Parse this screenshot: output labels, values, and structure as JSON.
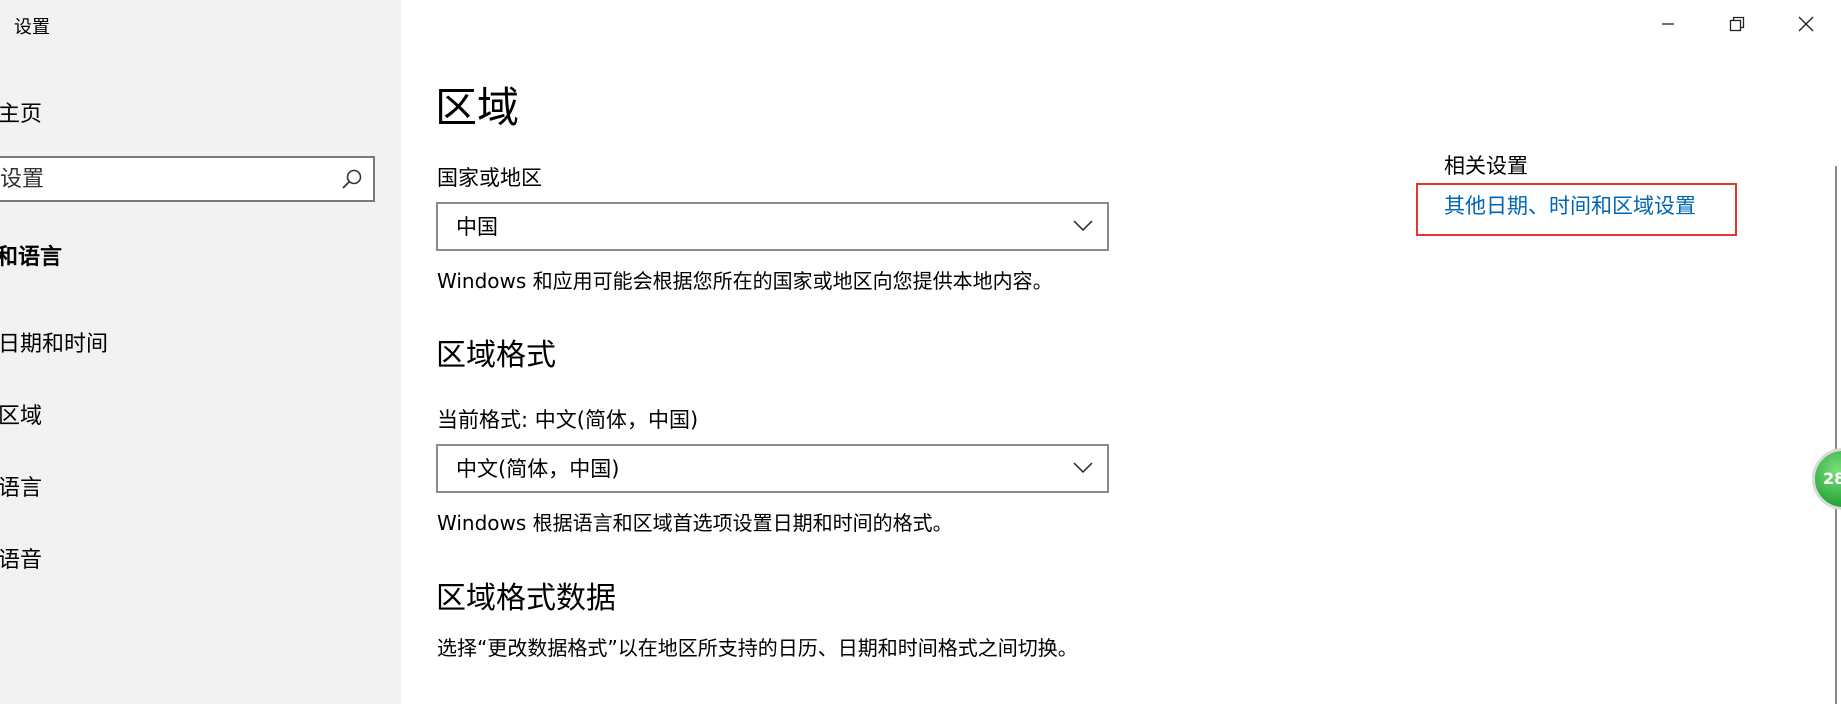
{
  "window": {
    "title": "设置"
  },
  "sidebar": {
    "home": "主页",
    "search_placeholder": "设置",
    "section": "和语言",
    "items": [
      {
        "label": "日期和时间"
      },
      {
        "label": "区域"
      },
      {
        "label": "语言"
      },
      {
        "label": "语音"
      }
    ]
  },
  "main": {
    "title": "区域",
    "country": {
      "label": "国家或地区",
      "value": "中国",
      "description": "Windows 和应用可能会根据您所在的国家或地区向您提供本地内容。"
    },
    "format": {
      "heading": "区域格式",
      "current_label": "当前格式: 中文(简体，中国)",
      "value": "中文(简体，中国)",
      "description": "Windows 根据语言和区域首选项设置日期和时间的格式。"
    },
    "format_data": {
      "heading": "区域格式数据",
      "description": "选择“更改数据格式”以在地区所支持的日历、日期和时间格式之间切换。"
    }
  },
  "related": {
    "heading": "相关设置",
    "link": "其他日期、时间和区域设置"
  },
  "widget": {
    "number": "28"
  },
  "colors": {
    "link": "#0066b4",
    "highlight": "#e53333",
    "sidebar_bg": "#f2f2f2"
  }
}
